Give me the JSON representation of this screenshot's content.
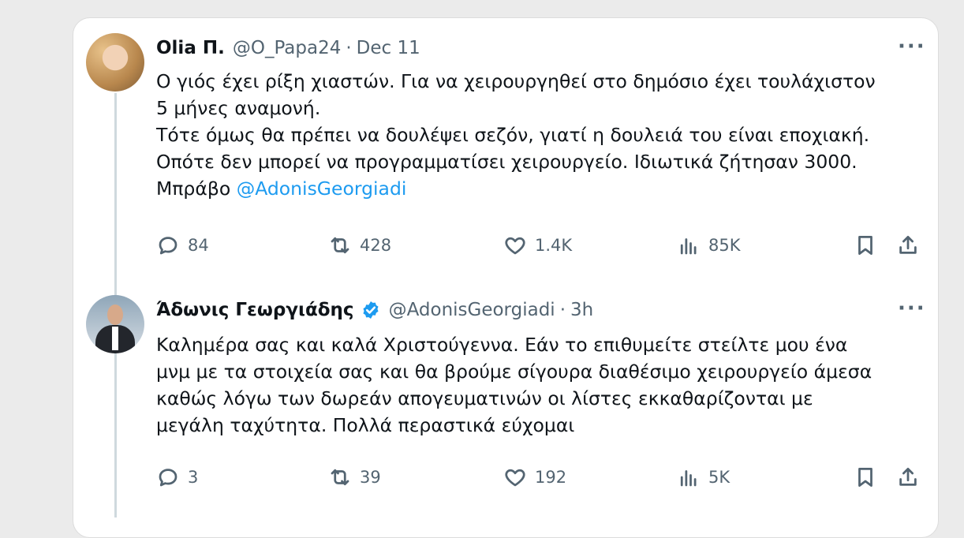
{
  "tweet1": {
    "name": "Olia Π.",
    "handle": "@O_Papa24",
    "separator": "·",
    "time": "Dec 11",
    "more": "···",
    "text": "Ο γιός έχει ρίξη χιαστών. Για να χειρουργηθεί στο δημόσιο έχει τουλάχιστον\n5 μήνες αναμονή.\nΤότε όμως θα πρέπει να δουλέψει σεζόν, γιατί η δουλειά του είναι εποχιακή.\nΟπότε δεν μπορεί να προγραμματίσει χειρουργείο. Ιδιωτικά ζήτησαν 3000.\nΜπράβο ",
    "mention": "@AdonisGeorgiadi",
    "replies": "84",
    "retweets": "428",
    "likes": "1.4K",
    "views": "85K"
  },
  "tweet2": {
    "name": "Άδωνις Γεωργιάδης",
    "verified": true,
    "verified_color": "#1d9bf0",
    "handle": "@AdonisGeorgiadi",
    "separator": "·",
    "time": "3h",
    "more": "···",
    "text": "Καλημέρα σας και καλά Χριστούγεννα. Εάν το επιθυμείτε στείλτε μου ένα\nμνμ με τα στοιχεία σας και θα βρούμε σίγουρα διαθέσιμο χειρουργείο άμεσα\nκαθώς λόγω των δωρεάν απογευματινών οι λίστες εκκαθαρίζονται με\nμεγάλη ταχύτητα. Πολλά περαστικά εύχομαι",
    "replies": "3",
    "retweets": "39",
    "likes": "192",
    "views": "5K"
  },
  "icons": [
    "reply-icon",
    "retweet-icon",
    "like-icon",
    "views-icon",
    "bookmark-icon",
    "share-icon"
  ],
  "colors": {
    "link": "#1d9bf0",
    "secondary_text": "#536471",
    "thread_line": "#cfd9de"
  }
}
